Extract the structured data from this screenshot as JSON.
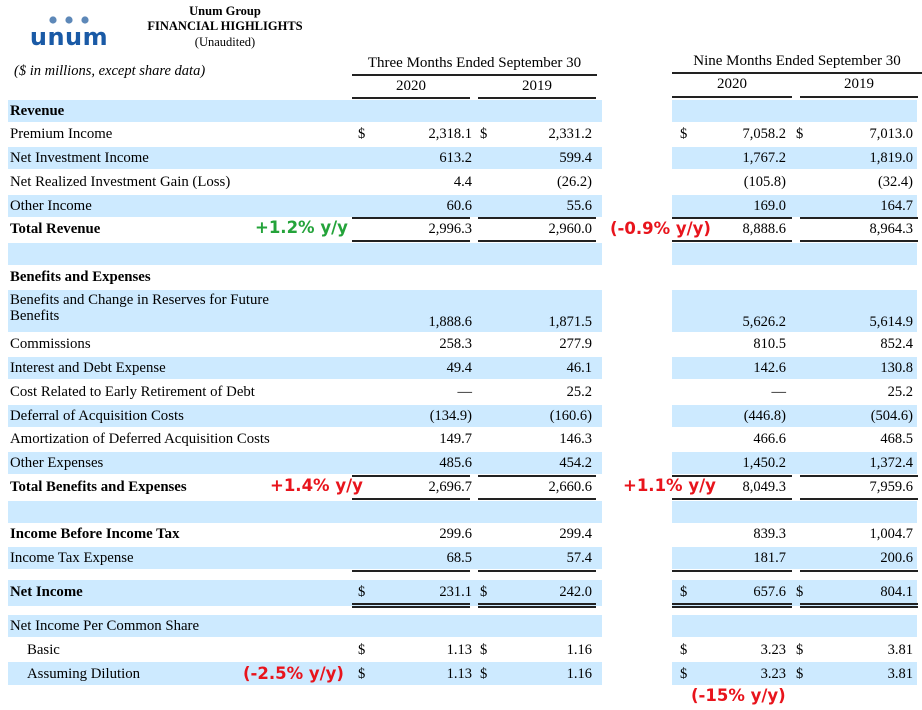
{
  "header": {
    "logo_text": "unum",
    "company": "Unum Group",
    "title": "FINANCIAL HIGHLIGHTS",
    "subtitle": "(Unaudited)",
    "units_note": "($ in millions, except share data)"
  },
  "columns": {
    "three_months": {
      "label": "Three Months Ended September 30",
      "years": [
        "2020",
        "2019"
      ]
    },
    "nine_months": {
      "label": "Nine Months Ended September 30",
      "years": [
        "2020",
        "2019"
      ]
    }
  },
  "currency_symbol": "$",
  "sections": {
    "revenue": {
      "heading": "Revenue",
      "rows": [
        {
          "label": "Premium Income",
          "q2020": "2,318.1",
          "q2019": "2,331.2",
          "n2020": "7,058.2",
          "n2019": "7,013.0"
        },
        {
          "label": "Net Investment Income",
          "q2020": "613.2",
          "q2019": "599.4",
          "n2020": "1,767.2",
          "n2019": "1,819.0"
        },
        {
          "label": "Net Realized Investment Gain (Loss)",
          "q2020": "4.4",
          "q2019": "(26.2)",
          "n2020": "(105.8)",
          "n2019": "(32.4)"
        },
        {
          "label": "Other Income",
          "q2020": "60.6",
          "q2019": "55.6",
          "n2020": "169.0",
          "n2019": "164.7"
        },
        {
          "label": "Total Revenue",
          "q2020": "2,996.3",
          "q2019": "2,960.0",
          "n2020": "8,888.6",
          "n2019": "8,964.3"
        }
      ]
    },
    "expenses": {
      "heading": "Benefits and Expenses",
      "rows": [
        {
          "label": "Benefits and Change in Reserves for Future",
          "label2": "Benefits",
          "q2020": "1,888.6",
          "q2019": "1,871.5",
          "n2020": "5,626.2",
          "n2019": "5,614.9"
        },
        {
          "label": "Commissions",
          "q2020": "258.3",
          "q2019": "277.9",
          "n2020": "810.5",
          "n2019": "852.4"
        },
        {
          "label": "Interest and Debt Expense",
          "q2020": "49.4",
          "q2019": "46.1",
          "n2020": "142.6",
          "n2019": "130.8"
        },
        {
          "label": "Cost Related to Early Retirement of Debt",
          "q2020": "—",
          "q2019": "25.2",
          "n2020": "—",
          "n2019": "25.2"
        },
        {
          "label": "Deferral of Acquisition Costs",
          "q2020": "(134.9)",
          "q2019": "(160.6)",
          "n2020": "(446.8)",
          "n2019": "(504.6)"
        },
        {
          "label": "Amortization of Deferred Acquisition Costs",
          "q2020": "149.7",
          "q2019": "146.3",
          "n2020": "466.6",
          "n2019": "468.5"
        },
        {
          "label": "Other Expenses",
          "q2020": "485.6",
          "q2019": "454.2",
          "n2020": "1,450.2",
          "n2019": "1,372.4"
        },
        {
          "label": "Total Benefits and Expenses",
          "q2020": "2,696.7",
          "q2019": "2,660.6",
          "n2020": "8,049.3",
          "n2019": "7,959.6"
        }
      ]
    },
    "income": {
      "rows": [
        {
          "label": "Income Before Income Tax",
          "q2020": "299.6",
          "q2019": "299.4",
          "n2020": "839.3",
          "n2019": "1,004.7"
        },
        {
          "label": "Income Tax Expense",
          "q2020": "68.5",
          "q2019": "57.4",
          "n2020": "181.7",
          "n2019": "200.6"
        },
        {
          "label": "Net Income",
          "q2020": "231.1",
          "q2019": "242.0",
          "n2020": "657.6",
          "n2019": "804.1"
        }
      ]
    },
    "per_share": {
      "heading": "Net Income Per Common Share",
      "rows": [
        {
          "label": "Basic",
          "q2020": "1.13",
          "q2019": "1.16",
          "n2020": "3.23",
          "n2019": "3.81"
        },
        {
          "label": "Assuming Dilution",
          "q2020": "1.13",
          "q2019": "1.16",
          "n2020": "3.23",
          "n2019": "3.81"
        }
      ]
    }
  },
  "annotations": {
    "revenue_q": {
      "text": "+1.2% y/y",
      "color": "#24a33a"
    },
    "revenue_n": {
      "text": "(-0.9% y/y)",
      "color": "#e8141c"
    },
    "expenses_q": {
      "text": "+1.4% y/y",
      "color": "#e8141c"
    },
    "expenses_n": {
      "text": "+1.1% y/y",
      "color": "#e8141c"
    },
    "eps_q": {
      "text": "(-2.5% y/y)",
      "color": "#e8141c"
    },
    "eps_n": {
      "text": "(-15% y/y)",
      "color": "#e8141c"
    }
  },
  "colors": {
    "band": "#cdeaff",
    "logo": "#1a5aa6",
    "logo_dots": "#5d88b8"
  }
}
